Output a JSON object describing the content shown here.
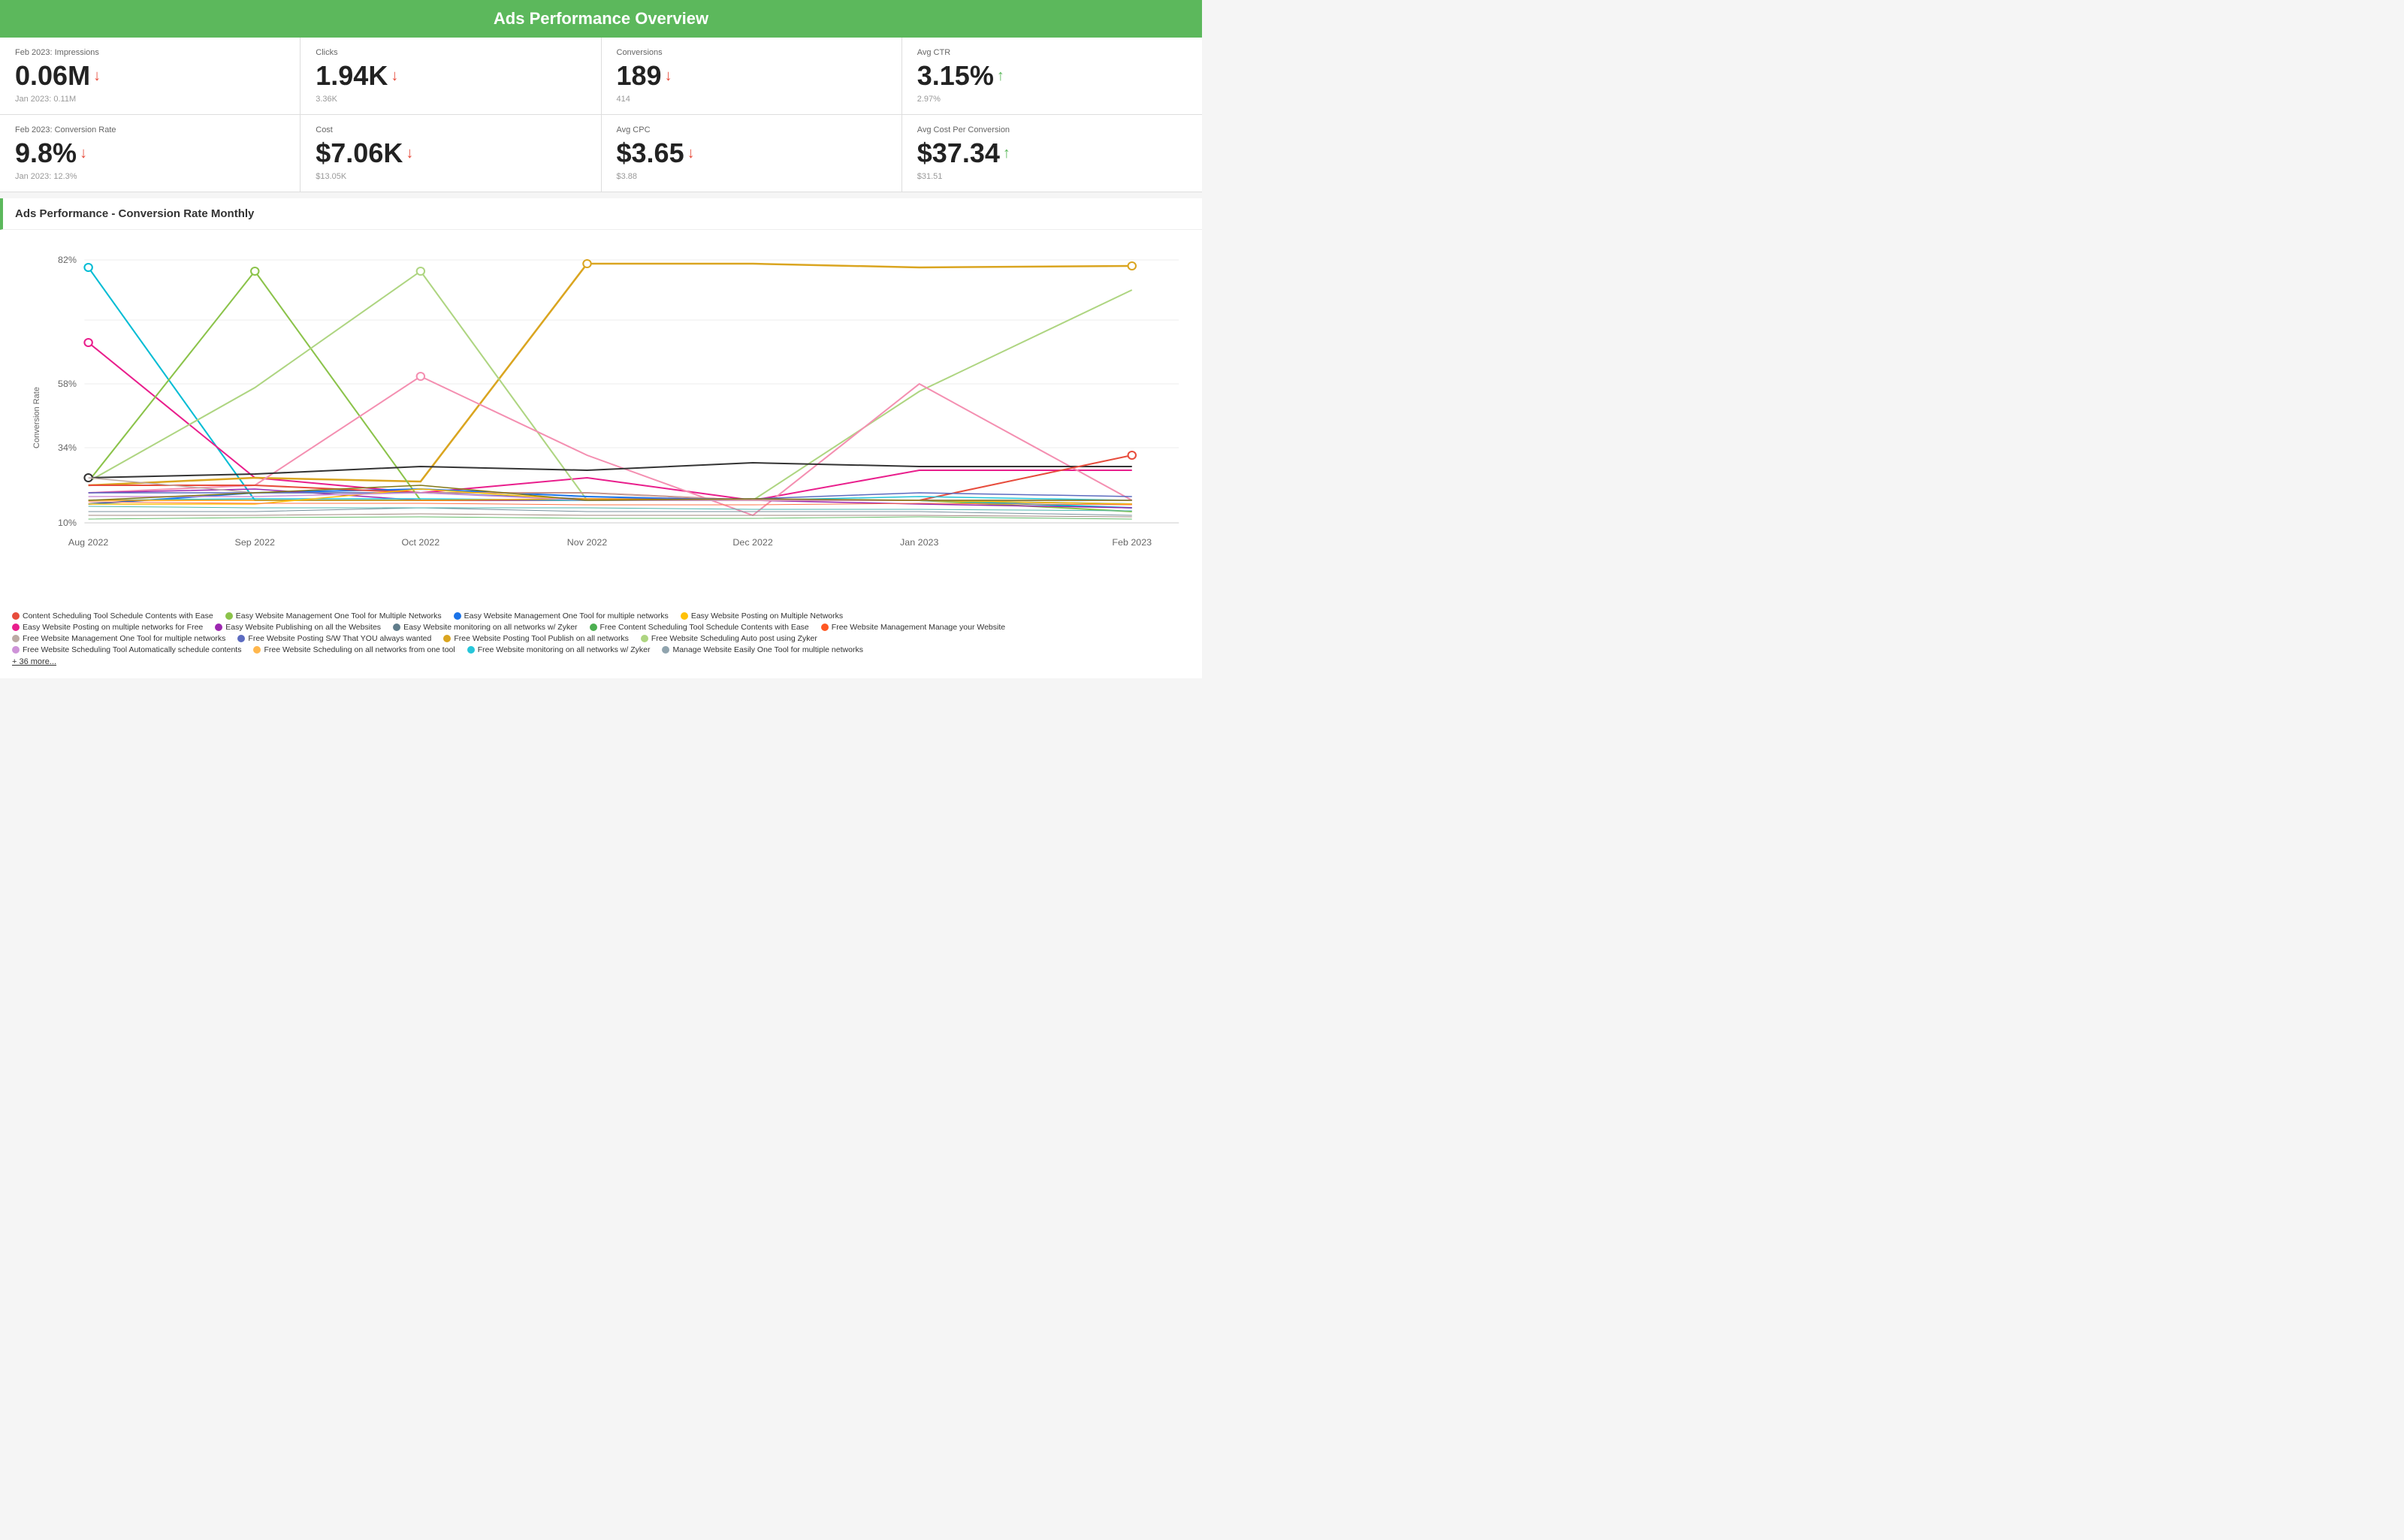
{
  "header": {
    "title": "Ads Performance Overview"
  },
  "metrics_row1": [
    {
      "label": "Feb 2023: Impressions",
      "value": "0.06M",
      "arrow": "down",
      "prev": "Jan 2023: 0.11M"
    },
    {
      "label": "Clicks",
      "value": "1.94K",
      "arrow": "down",
      "prev": "3.36K"
    },
    {
      "label": "Conversions",
      "value": "189",
      "arrow": "down",
      "prev": "414"
    },
    {
      "label": "Avg CTR",
      "value": "3.15%",
      "arrow": "up",
      "prev": "2.97%"
    }
  ],
  "metrics_row2": [
    {
      "label": "Feb 2023: Conversion Rate",
      "value": "9.8%",
      "arrow": "down",
      "prev": "Jan 2023: 12.3%"
    },
    {
      "label": "Cost",
      "value": "$7.06K",
      "arrow": "down",
      "prev": "$13.05K"
    },
    {
      "label": "Avg CPC",
      "value": "$3.65",
      "arrow": "down",
      "prev": "$3.88"
    },
    {
      "label": "Avg Cost Per Conversion",
      "value": "$37.34",
      "arrow": "up",
      "prev": "$31.51"
    }
  ],
  "chart": {
    "title": "Ads Performance - Conversion Rate Monthly",
    "y_label": "Conversion Rate",
    "y_ticks": [
      "10%",
      "34%",
      "58%",
      "82%"
    ],
    "x_ticks": [
      "Aug 2022",
      "Sep 2022",
      "Oct 2022",
      "Nov 2022",
      "Dec 2022",
      "Jan 2023",
      "Feb 2023"
    ]
  },
  "legend": {
    "items": [
      {
        "label": "Content Scheduling Tool Schedule Contents with Ease",
        "color": "#e74c3c"
      },
      {
        "label": "Easy Website Management One Tool for Multiple Networks",
        "color": "#8BC34A"
      },
      {
        "label": "Easy Website Management One Tool for multiple networks",
        "color": "#1a73e8"
      },
      {
        "label": "Easy Website Posting on Multiple Networks",
        "color": "#FFC107"
      },
      {
        "label": "Easy Website Posting on multiple networks for Free",
        "color": "#e91e8c"
      },
      {
        "label": "Easy Website Publishing on all the Websites",
        "color": "#9C27B0"
      },
      {
        "label": "Easy Website monitoring on all networks w/ Zyker",
        "color": "#607D8B"
      },
      {
        "label": "Free Content Scheduling Tool Schedule Contents with Ease",
        "color": "#4CAF50"
      },
      {
        "label": "Free Website Management Manage your Website",
        "color": "#FF5722"
      },
      {
        "label": "Free Website Management One Tool for multiple networks",
        "color": "#BCAAA4"
      },
      {
        "label": "Free Website Posting S/W That YOU always wanted",
        "color": "#5C6BC0"
      },
      {
        "label": "Free Website Posting Tool Publish on all networks",
        "color": "#DAA520"
      },
      {
        "label": "Free Website Scheduling Auto post using Zyker",
        "color": "#AED581"
      },
      {
        "label": "Free Website Scheduling Tool Automatically schedule contents",
        "color": "#CE93D8"
      },
      {
        "label": "Free Website Scheduling on all networks from one tool",
        "color": "#FFB74D"
      },
      {
        "label": "Free Website monitoring on all networks w/ Zyker",
        "color": "#26C6DA"
      },
      {
        "label": "Manage Website Easily One Tool for multiple networks",
        "color": "#90A4AE"
      }
    ],
    "more": "+ 36 more..."
  }
}
